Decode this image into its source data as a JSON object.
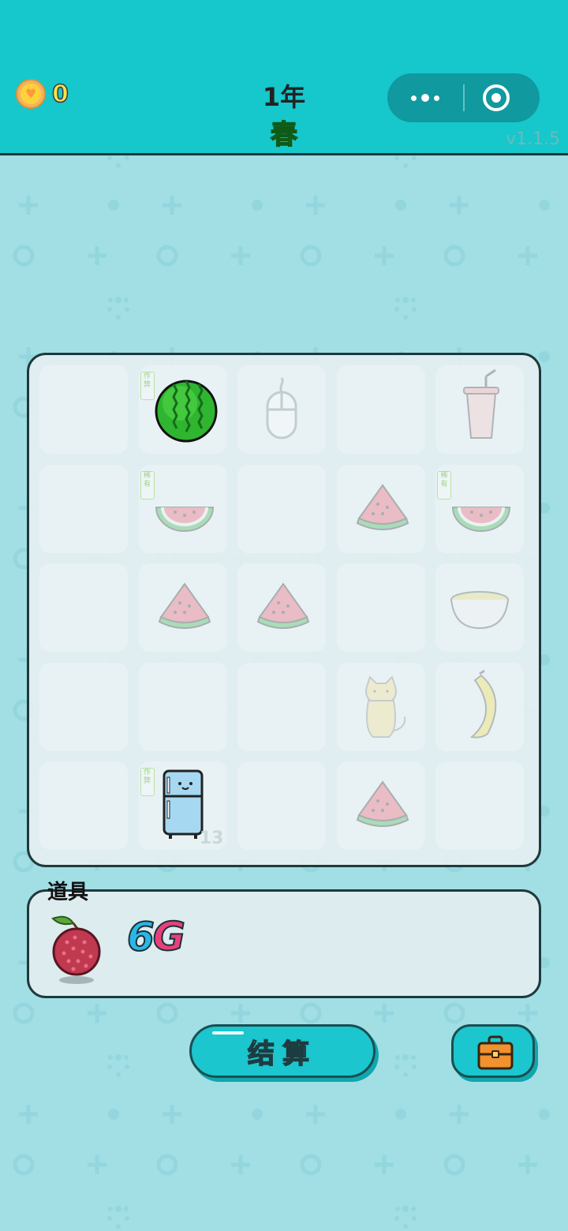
{
  "header": {
    "coins": "0",
    "year": "1年",
    "season": "春",
    "version": "v1.1.5"
  },
  "board": {
    "rows": 5,
    "cols": 5,
    "cells": [
      {
        "row": 0,
        "col": 0,
        "item": "empty"
      },
      {
        "row": 0,
        "col": 1,
        "item": "watermelon",
        "tag": "作弊",
        "active": true
      },
      {
        "row": 0,
        "col": 2,
        "item": "mouse"
      },
      {
        "row": 0,
        "col": 3,
        "item": "empty"
      },
      {
        "row": 0,
        "col": 4,
        "item": "drink-cup"
      },
      {
        "row": 1,
        "col": 0,
        "item": "empty"
      },
      {
        "row": 1,
        "col": 1,
        "item": "watermelon-slice",
        "tag": "稀有"
      },
      {
        "row": 1,
        "col": 2,
        "item": "empty"
      },
      {
        "row": 1,
        "col": 3,
        "item": "watermelon-wedge"
      },
      {
        "row": 1,
        "col": 4,
        "item": "watermelon-slice",
        "tag": "稀有"
      },
      {
        "row": 2,
        "col": 0,
        "item": "empty"
      },
      {
        "row": 2,
        "col": 1,
        "item": "watermelon-wedge"
      },
      {
        "row": 2,
        "col": 2,
        "item": "watermelon-wedge"
      },
      {
        "row": 2,
        "col": 3,
        "item": "empty"
      },
      {
        "row": 2,
        "col": 4,
        "item": "bowl"
      },
      {
        "row": 3,
        "col": 0,
        "item": "empty"
      },
      {
        "row": 3,
        "col": 1,
        "item": "empty"
      },
      {
        "row": 3,
        "col": 2,
        "item": "empty"
      },
      {
        "row": 3,
        "col": 3,
        "item": "cat"
      },
      {
        "row": 3,
        "col": 4,
        "item": "banana"
      },
      {
        "row": 4,
        "col": 0,
        "item": "empty"
      },
      {
        "row": 4,
        "col": 1,
        "item": "fridge",
        "tag": "作弊",
        "active": true,
        "count": "13"
      },
      {
        "row": 4,
        "col": 2,
        "item": "empty"
      },
      {
        "row": 4,
        "col": 3,
        "item": "watermelon-wedge"
      },
      {
        "row": 4,
        "col": 4,
        "item": "empty"
      }
    ]
  },
  "tools": {
    "label": "道具",
    "item_icon": "lychee-icon",
    "logo_6": "6",
    "logo_g": "G"
  },
  "buttons": {
    "settle_label": "结算",
    "bag_icon": "briefcase-icon"
  },
  "colors": {
    "header_bg": "#16c7cc",
    "page_bg": "#a1dfe5",
    "button_bg": "#1cc6ce",
    "season_green": "#2bd640",
    "coin_yellow": "#ffe14a"
  }
}
